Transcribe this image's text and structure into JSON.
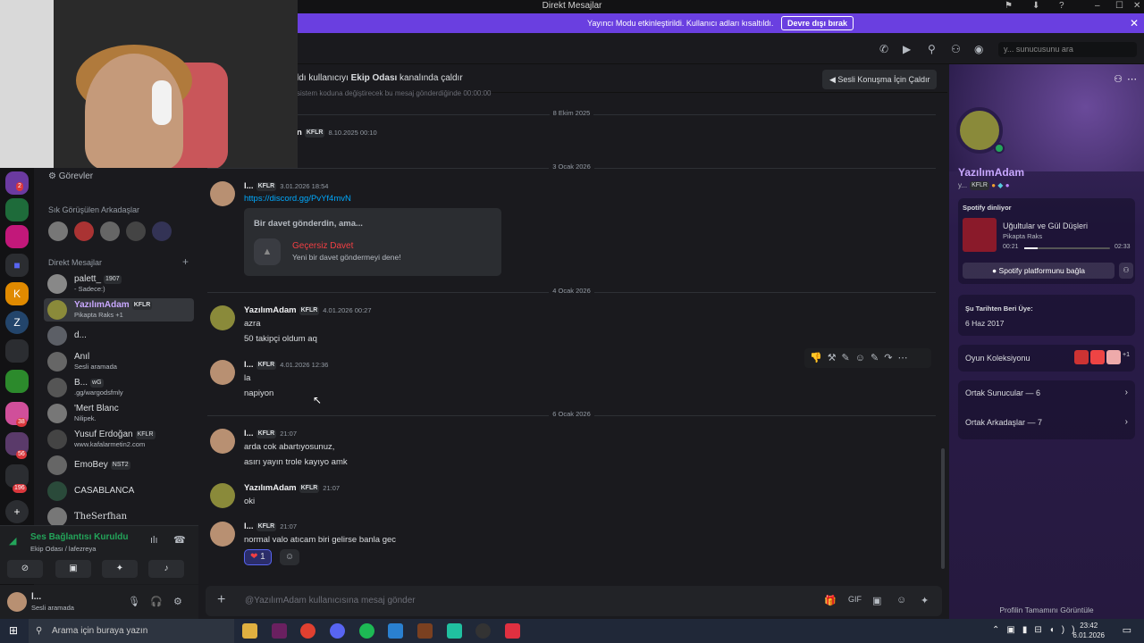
{
  "window": {
    "title": "Direkt Mesajlar"
  },
  "streamer_banner": {
    "text": "Yayıncı Modu etkinleştirildi. Kullanıcı adları kısaltıldı.",
    "button": "Devre dışı bırak"
  },
  "topbar": {
    "search_placeholder": "y... sunucusunu ara"
  },
  "callbar": {
    "text_pre": "ldı kullanıcıyı ",
    "channel": "Ekip Odası",
    "text_post": " kanalında çaldır",
    "button": "Sesli Konuşma İçin Çaldır"
  },
  "guild_badges": [
    "2",
    "38",
    "56",
    "196"
  ],
  "dm_sidebar": {
    "tasks": "Görevler",
    "frequent_title": "Sık Görüşülen Arkadaşlar",
    "dm_title": "Direkt Mesajlar",
    "dms": [
      {
        "name": "palett_",
        "tag": "1907",
        "sub": "- Sadece:)"
      },
      {
        "name": "YazılımAdam",
        "tag": "KFLR",
        "sub": "Pikapta Raks +1"
      },
      {
        "name": "d...",
        "tag": "",
        "sub": ""
      },
      {
        "name": "Anıl",
        "tag": "",
        "sub": "Sesli aramada"
      },
      {
        "name": "B...",
        "tag": "wG",
        "sub": ".gg/wargodsfmly"
      },
      {
        "name": "'Mert Blanc",
        "tag": "",
        "sub": "Nilipek."
      },
      {
        "name": "Yusuf Erdoğan",
        "tag": "KFLR",
        "sub": "www.kafalarmetin2.com"
      },
      {
        "name": "EmoBey",
        "tag": "NST2",
        "sub": ""
      },
      {
        "name": "CASABLANCA",
        "tag": "",
        "sub": ""
      },
      {
        "name": "TheSerfhan",
        "tag": "",
        "sub": ""
      }
    ]
  },
  "voice": {
    "status": "Ses Bağlantısı Kuruldu",
    "channel": "Ekip Odası / lafezreya"
  },
  "user": {
    "name": "l...",
    "status": "Sesli aramada"
  },
  "chat": {
    "top_line": "sistem koduna değiştirecek bu mesaj gönderdiğinde 00:00:00",
    "dividers": [
      "8 Ekim 2025",
      "3 Ocak 2026",
      "4 Ocak 2026",
      "6 Ocak 2026"
    ],
    "messages": [
      {
        "author": "n",
        "tag": "KFLR",
        "time": "8.10.2025 00:10",
        "lines": []
      },
      {
        "author": "l...",
        "tag": "KFLR",
        "time": "3.01.2026 18:54",
        "lines": [
          "https://discord.gg/PvYf4mvN"
        ]
      },
      {
        "author": "YazılımAdam",
        "tag": "KFLR",
        "time": "4.01.2026 00:27",
        "lines": [
          "azra",
          "50 takipçi oldum aq"
        ]
      },
      {
        "author": "l...",
        "tag": "KFLR",
        "time": "4.01.2026 12:36",
        "lines": [
          "la",
          "napiyon"
        ]
      },
      {
        "author": "l...",
        "tag": "KFLR",
        "time": "21:07",
        "lines": [
          "arda cok abartıyosunuz,",
          "asırı yayın trole kayıyo amk"
        ]
      },
      {
        "author": "YazılımAdam",
        "tag": "KFLR",
        "time": "21:07",
        "lines": [
          "oki"
        ]
      },
      {
        "author": "l...",
        "tag": "KFLR",
        "time": "21:07",
        "lines": [
          "normal valo atıcam biri gelirse banla gec"
        ]
      }
    ],
    "invite": {
      "header": "Bir davet gönderdin, ama...",
      "title": "Geçersiz Davet",
      "sub": "Yeni bir davet göndermeyi dene!"
    },
    "reaction": {
      "emoji": "❤",
      "count": "1"
    },
    "input_placeholder": "@YazılımAdam kullanıcısına mesaj gönder"
  },
  "profile": {
    "name": "YazılımAdam",
    "short": "y...",
    "tag": "KFLR",
    "spotify_title": "Spotify dinliyor",
    "song": "Uğultular ve Gül Düşleri",
    "artist": "Pikapta Raks",
    "t_start": "00:21",
    "t_end": "02:33",
    "progress": 0.16,
    "spotify_btn": "Spotify platformunu bağla",
    "member_since_title": "Şu Tarihten Beri Üye:",
    "member_since": "6 Haz 2017",
    "games": "Oyun Koleksiyonu",
    "games_more": "+1",
    "mutual_servers": "Ortak Sunucular — 6",
    "mutual_friends": "Ortak Arkadaşlar — 7",
    "full_profile": "Profilin Tamamını Görüntüle"
  },
  "taskbar": {
    "search": "Arama için buraya yazın",
    "time": "23:42",
    "date": "6.01.2026"
  },
  "colors": {
    "accent": "#5865f2",
    "danger": "#da373c",
    "link": "#00a8fc",
    "online": "#23a55a"
  }
}
